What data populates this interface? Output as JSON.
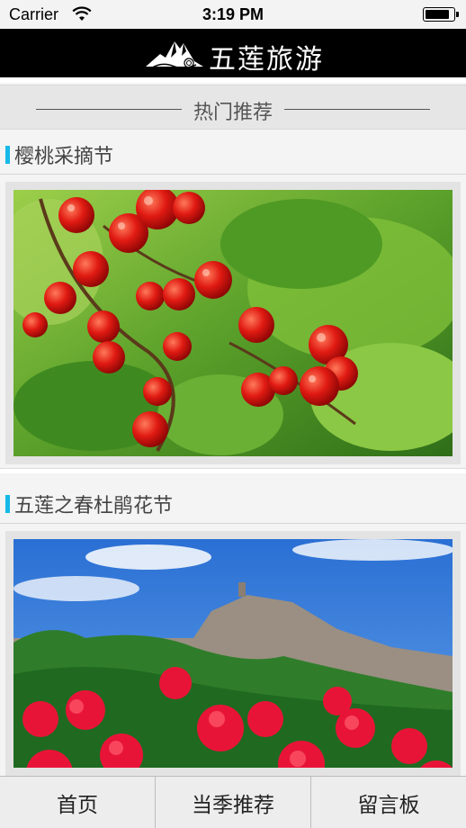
{
  "status": {
    "carrier": "Carrier",
    "time": "3:19 PM",
    "battery_level": 0.9
  },
  "nav": {
    "title": "五莲旅游",
    "logo_icon": "mountain-cloud-logo"
  },
  "section": {
    "title": "热门推荐"
  },
  "items": [
    {
      "title": "樱桃采摘节",
      "image": "cherry-photo"
    },
    {
      "title": "五莲之春杜鹃花节",
      "image": "azalea-mountain-photo"
    }
  ],
  "tabs": [
    {
      "label": "首页"
    },
    {
      "label": "当季推荐"
    },
    {
      "label": "留言板"
    }
  ],
  "colors": {
    "accent": "#16b9e8",
    "navbar": "#000000"
  }
}
